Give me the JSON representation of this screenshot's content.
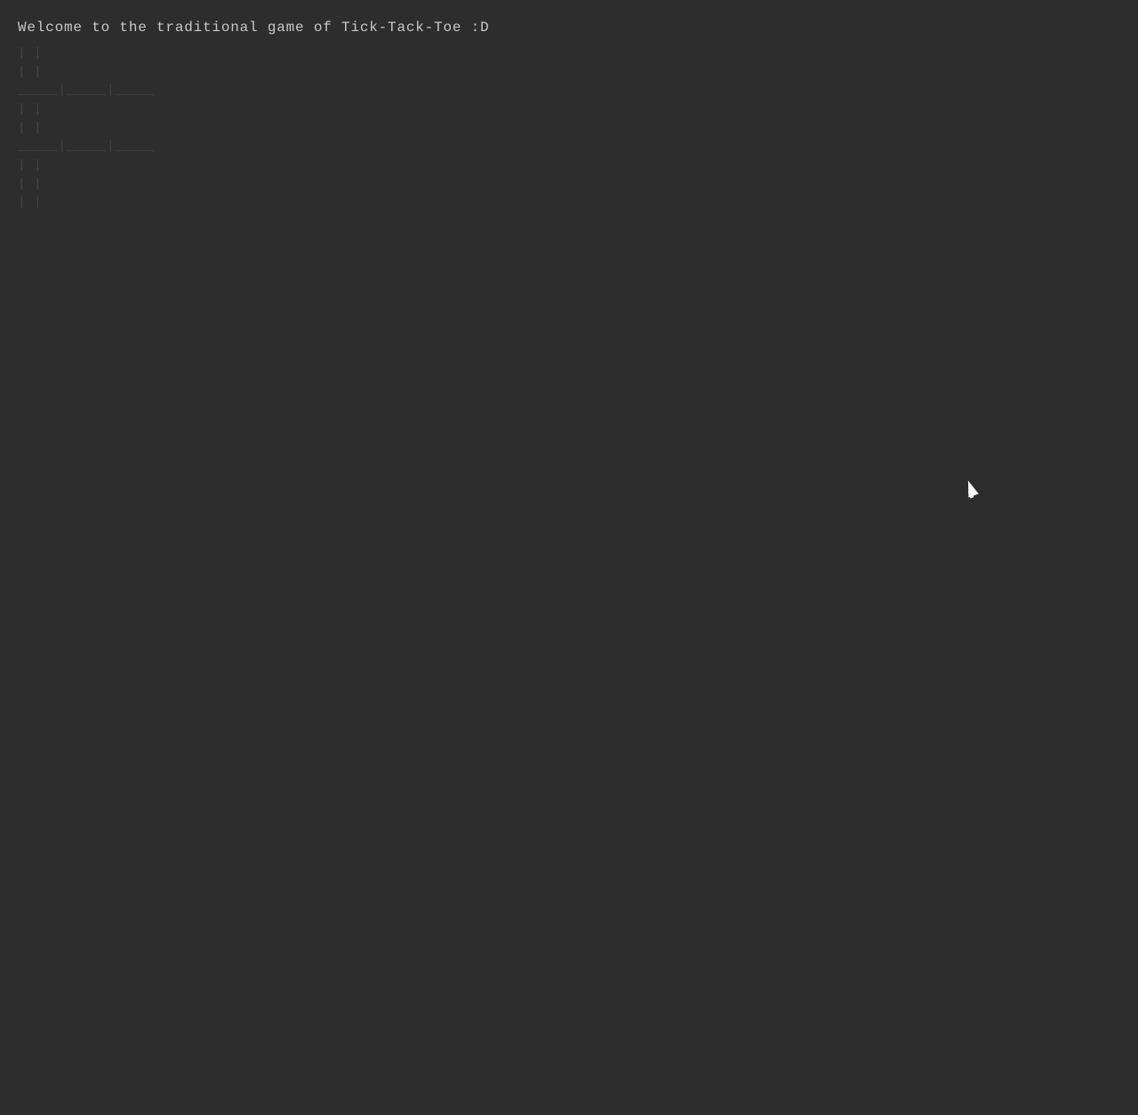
{
  "terminal": {
    "background_color": "#2d2d2d",
    "text_color": "#c8c8c8",
    "welcome_message": "Welcome to the traditional game of Tick-Tack-Toe :D",
    "grid_rows": [
      "     |     |     ",
      "     |     |     ",
      "_____|_____|_____",
      "     |     |     ",
      "     |     |     ",
      "_____|_____|_____",
      "     |     |     ",
      "     |     |     ",
      "     |     |     "
    ]
  }
}
